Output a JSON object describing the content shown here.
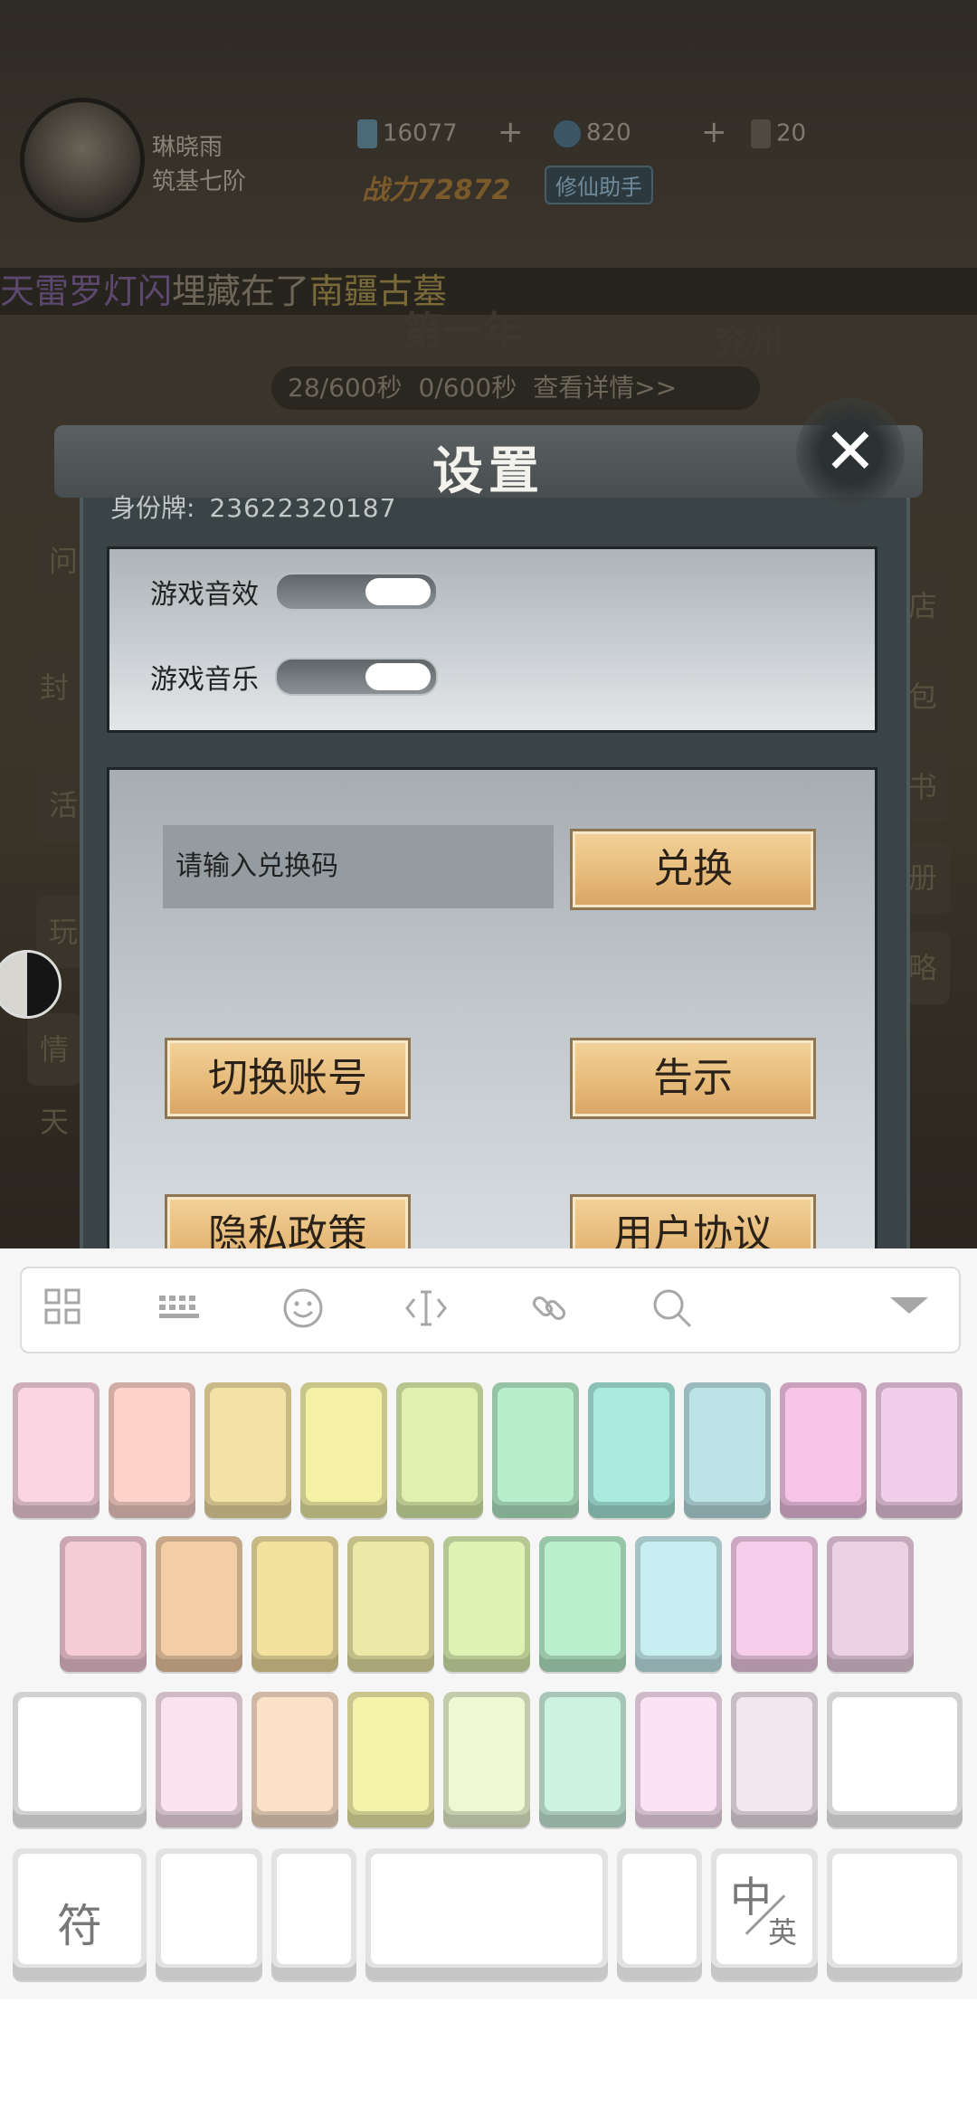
{
  "player": {
    "name": "琳晓雨",
    "rank": "筑基七阶"
  },
  "resources": {
    "crystals": "16077",
    "coins": "820",
    "scrolls": "20"
  },
  "power": "战力72872",
  "helper_button": "修仙助手",
  "ticker": {
    "lead": "天雷罗灯闪",
    "middle": "埋藏在了",
    "place": "南疆古墓"
  },
  "year_text": "第一年",
  "region_text": "兖州",
  "timers": {
    "crystal": "28/600秒",
    "scroll": "0/600秒",
    "details": "查看详情>>"
  },
  "side_left": [
    "问",
    "封",
    "活",
    "玩",
    "情天"
  ],
  "side_right": [
    "店",
    "包",
    "书",
    "册",
    "略"
  ],
  "settings": {
    "title": "设置",
    "close": "✕",
    "id_label": "身份牌:",
    "id_value": "23622320187",
    "sound_effects_label": "游戏音效",
    "music_label": "游戏音乐",
    "sound_effects_on": true,
    "music_on": true,
    "redeem_placeholder": "请输入兑换码",
    "redeem_button": "兑换",
    "switch_account": "切换账号",
    "notice": "告示",
    "privacy": "隐私政策",
    "user_agreement": "用户协议"
  },
  "keyboard": {
    "toolbar_icons": [
      "grid-icon",
      "keyboard-icon",
      "emoji-icon",
      "cursor-icon",
      "link-icon",
      "search-icon",
      "collapse-icon"
    ],
    "symbol_key": "符",
    "lang_key_main": "中",
    "lang_key_sub": "英",
    "row1_colors": [
      "#fbd6e2",
      "#fdd3c9",
      "#f4e2a4",
      "#f4f0a6",
      "#def1ae",
      "#b7eecb",
      "#a9ebdf",
      "#bce3e6",
      "#f5c4e7",
      "#f0cde8"
    ],
    "row2_colors": [
      "#f6cbd8",
      "#f2cda6",
      "#f3e1a0",
      "#ece8a8",
      "#def3b3",
      "#b9efcd",
      "#c7eef1",
      "#f5cdea",
      "#eed0e4"
    ],
    "row3_colors": [
      "#ffffff",
      "#fbe4ef",
      "#fce1c9",
      "#f4f2ab",
      "#eef8d3",
      "#ccf2e0",
      "#fbe3f5",
      "#f4e6ef",
      "#ffffff"
    ]
  }
}
